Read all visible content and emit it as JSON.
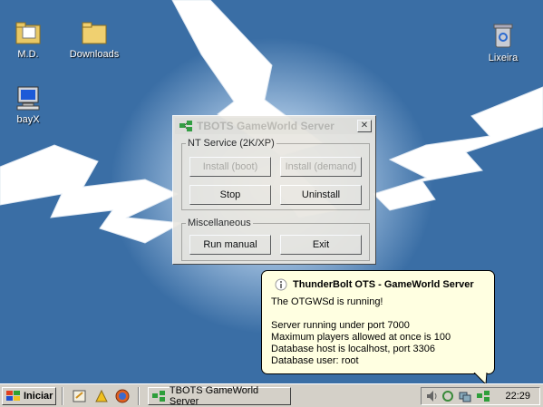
{
  "desktop": {
    "icons": [
      {
        "label": "M.D."
      },
      {
        "label": "Downloads"
      },
      {
        "label": "Lixeira"
      },
      {
        "label": "bayX"
      }
    ]
  },
  "window": {
    "title": "TBOTS GameWorld Server",
    "close_label": "✕",
    "nt_group": {
      "legend": "NT Service (2K/XP)",
      "install_boot": "Install (boot)",
      "install_demand": "Install (demand)",
      "stop": "Stop",
      "uninstall": "Uninstall"
    },
    "misc_group": {
      "legend": "Miscellaneous",
      "run_manual": "Run manual",
      "exit": "Exit"
    }
  },
  "balloon": {
    "title": "ThunderBolt OTS - GameWorld Server",
    "lines": [
      "The OTGWSd is running!",
      "Server running under port 7000",
      "Maximum players allowed at once is 100",
      "Database host is localhost, port 3306",
      "Database user: root"
    ]
  },
  "taskbar": {
    "start_label": "Iniciar",
    "task_label": "TBOTS GameWorld Server",
    "clock": "22:29"
  },
  "colors": {
    "desktop_bg": "#3a6ea5",
    "taskbar_bg": "#d4d0c8",
    "balloon_bg": "#ffffe1"
  }
}
